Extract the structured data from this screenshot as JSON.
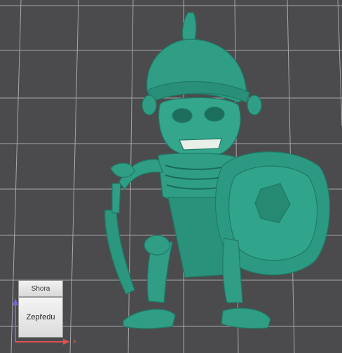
{
  "viewport": {
    "background": "#4b4b4d",
    "grid_color": "#b9b9bb",
    "model_color": "#2f9e85",
    "model_name": "skeleton-warrior-model"
  },
  "view_cube": {
    "top_label": "Shora",
    "front_label": "Zepředu",
    "axis_x_label": "x",
    "axis_x_color": "#e05050",
    "axis_z_color": "#6a6ad8"
  }
}
